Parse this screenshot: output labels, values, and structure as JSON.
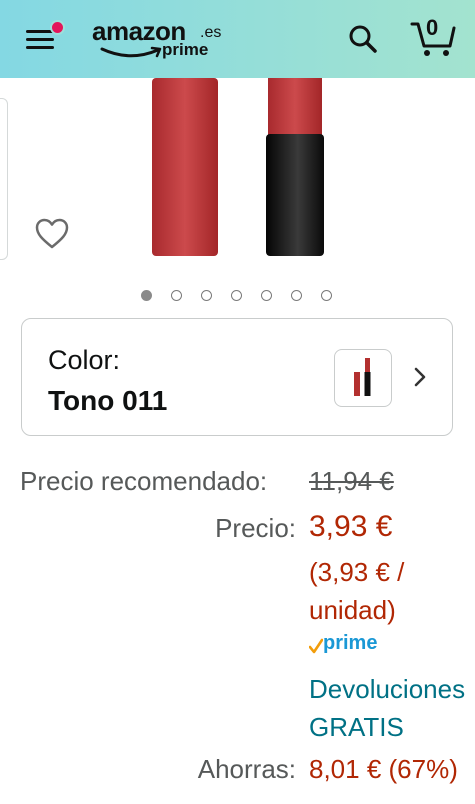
{
  "header": {
    "logo_word": "amazon",
    "logo_tld": ".es",
    "logo_prime": "prime",
    "cart_count": "0",
    "colors": {
      "gradient_start": "#84d8e3",
      "gradient_end": "#a3e3cf",
      "notification_dot": "#e3155a"
    }
  },
  "gallery": {
    "image_count": 7,
    "active_index": 0,
    "icons": [
      "heart-icon"
    ]
  },
  "color_selector": {
    "label": "Color:",
    "value": "Tono 011"
  },
  "pricing": {
    "list_label": "Precio recomendado:",
    "list_value": "11,94 €",
    "price_label": "Precio:",
    "price_value": "3,93 €",
    "unit_price": "(3,93 € / unidad)",
    "prime_label": "prime",
    "returns_text": "Devoluciones GRATIS",
    "savings_label": "Ahorras:",
    "savings_value": "8,01 € (67%)",
    "price_color": "#b12704",
    "link_color": "#007185"
  }
}
